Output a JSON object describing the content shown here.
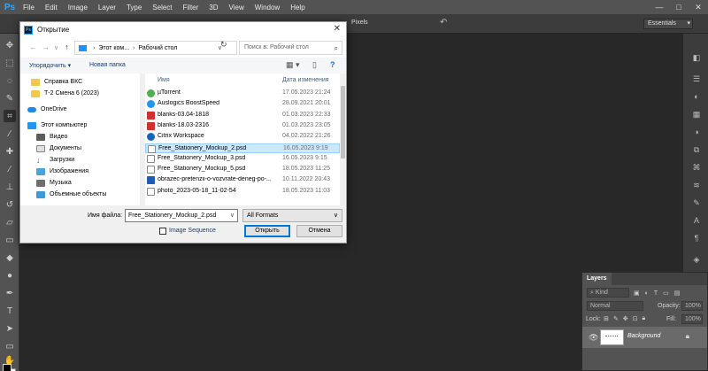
{
  "app": {
    "logo": "Ps",
    "menu": [
      "File",
      "Edit",
      "Image",
      "Layer",
      "Type",
      "Select",
      "Filter",
      "3D",
      "View",
      "Window",
      "Help"
    ],
    "window_controls": [
      "—",
      "□",
      "✕"
    ]
  },
  "options_bar": {
    "pixels_label": "Pixels",
    "workspace": "Essentials"
  },
  "layers_panel": {
    "tab": "Layers",
    "kind_label": "Kind",
    "blend_mode": "Normal",
    "opacity_label": "Opacity:",
    "opacity_value": "100%",
    "lock_label": "Lock:",
    "fill_label": "Fill:",
    "fill_value": "100%",
    "layer_name": "Background"
  },
  "dialog": {
    "title": "Открытие",
    "address": {
      "parts": [
        "Этот ком...",
        "Рабочий стол"
      ]
    },
    "search_placeholder": "Поиск в: Рабочий стол",
    "organize": "Упорядочить ▾",
    "new_folder": "Новая папка",
    "nav_items": [
      {
        "label": "Справка ВКС",
        "icon": "folder"
      },
      {
        "label": "Т-2 Смена 6 (2023)",
        "icon": "folder"
      },
      {
        "label": "OneDrive",
        "icon": "cloud"
      },
      {
        "label": "Этот компьютер",
        "icon": "pc"
      },
      {
        "label": "Видео",
        "icon": "vid"
      },
      {
        "label": "Документы",
        "icon": "doc"
      },
      {
        "label": "Загрузки",
        "icon": "down"
      },
      {
        "label": "Изображения",
        "icon": "img"
      },
      {
        "label": "Музыка",
        "icon": "mus"
      },
      {
        "label": "Объемные объекты",
        "icon": "obj"
      }
    ],
    "columns": {
      "name": "Имя",
      "modified": "Дата изменения"
    },
    "files": [
      {
        "name": "µTorrent",
        "date": "17.05.2023 21:24",
        "icon": "fi-torrent",
        "selected": false
      },
      {
        "name": "Auslogics BoostSpeed",
        "date": "28.09.2021 20:01",
        "icon": "fi-auslogics",
        "selected": false
      },
      {
        "name": "blanks-03.04-1818",
        "date": "01.03.2023 22:33",
        "icon": "fi-pdf",
        "selected": false
      },
      {
        "name": "blanks-18.03-2316",
        "date": "01.03.2023 23:05",
        "icon": "fi-pdf",
        "selected": false
      },
      {
        "name": "Citrix Workspace",
        "date": "04.02.2022 21:26",
        "icon": "fi-citrix",
        "selected": false
      },
      {
        "name": "Free_Stationery_Mockup_2.psd",
        "date": "16.05.2023 9:19",
        "icon": "fi-psd",
        "selected": true
      },
      {
        "name": "Free_Stationery_Mockup_3.psd",
        "date": "16.05.2023 9:15",
        "icon": "fi-psd",
        "selected": false
      },
      {
        "name": "Free_Stationery_Mockup_5.psd",
        "date": "18.05.2023 11:25",
        "icon": "fi-psd",
        "selected": false
      },
      {
        "name": "obrazec-pretenzii-o-vozvrate-deneg-po-...",
        "date": "10.11.2022 20:43",
        "icon": "fi-word",
        "selected": false
      },
      {
        "name": "photo_2023-05-18_11-02-54",
        "date": "18.05.2023 11:03",
        "icon": "fi-image",
        "selected": false
      }
    ],
    "filename_label": "Имя файла:",
    "filename_value": "Free_Stationery_Mockup_2.psd",
    "format_value": "All Formats",
    "image_sequence": "Image Sequence",
    "open_button": "Открыть",
    "cancel_button": "Отмена"
  }
}
